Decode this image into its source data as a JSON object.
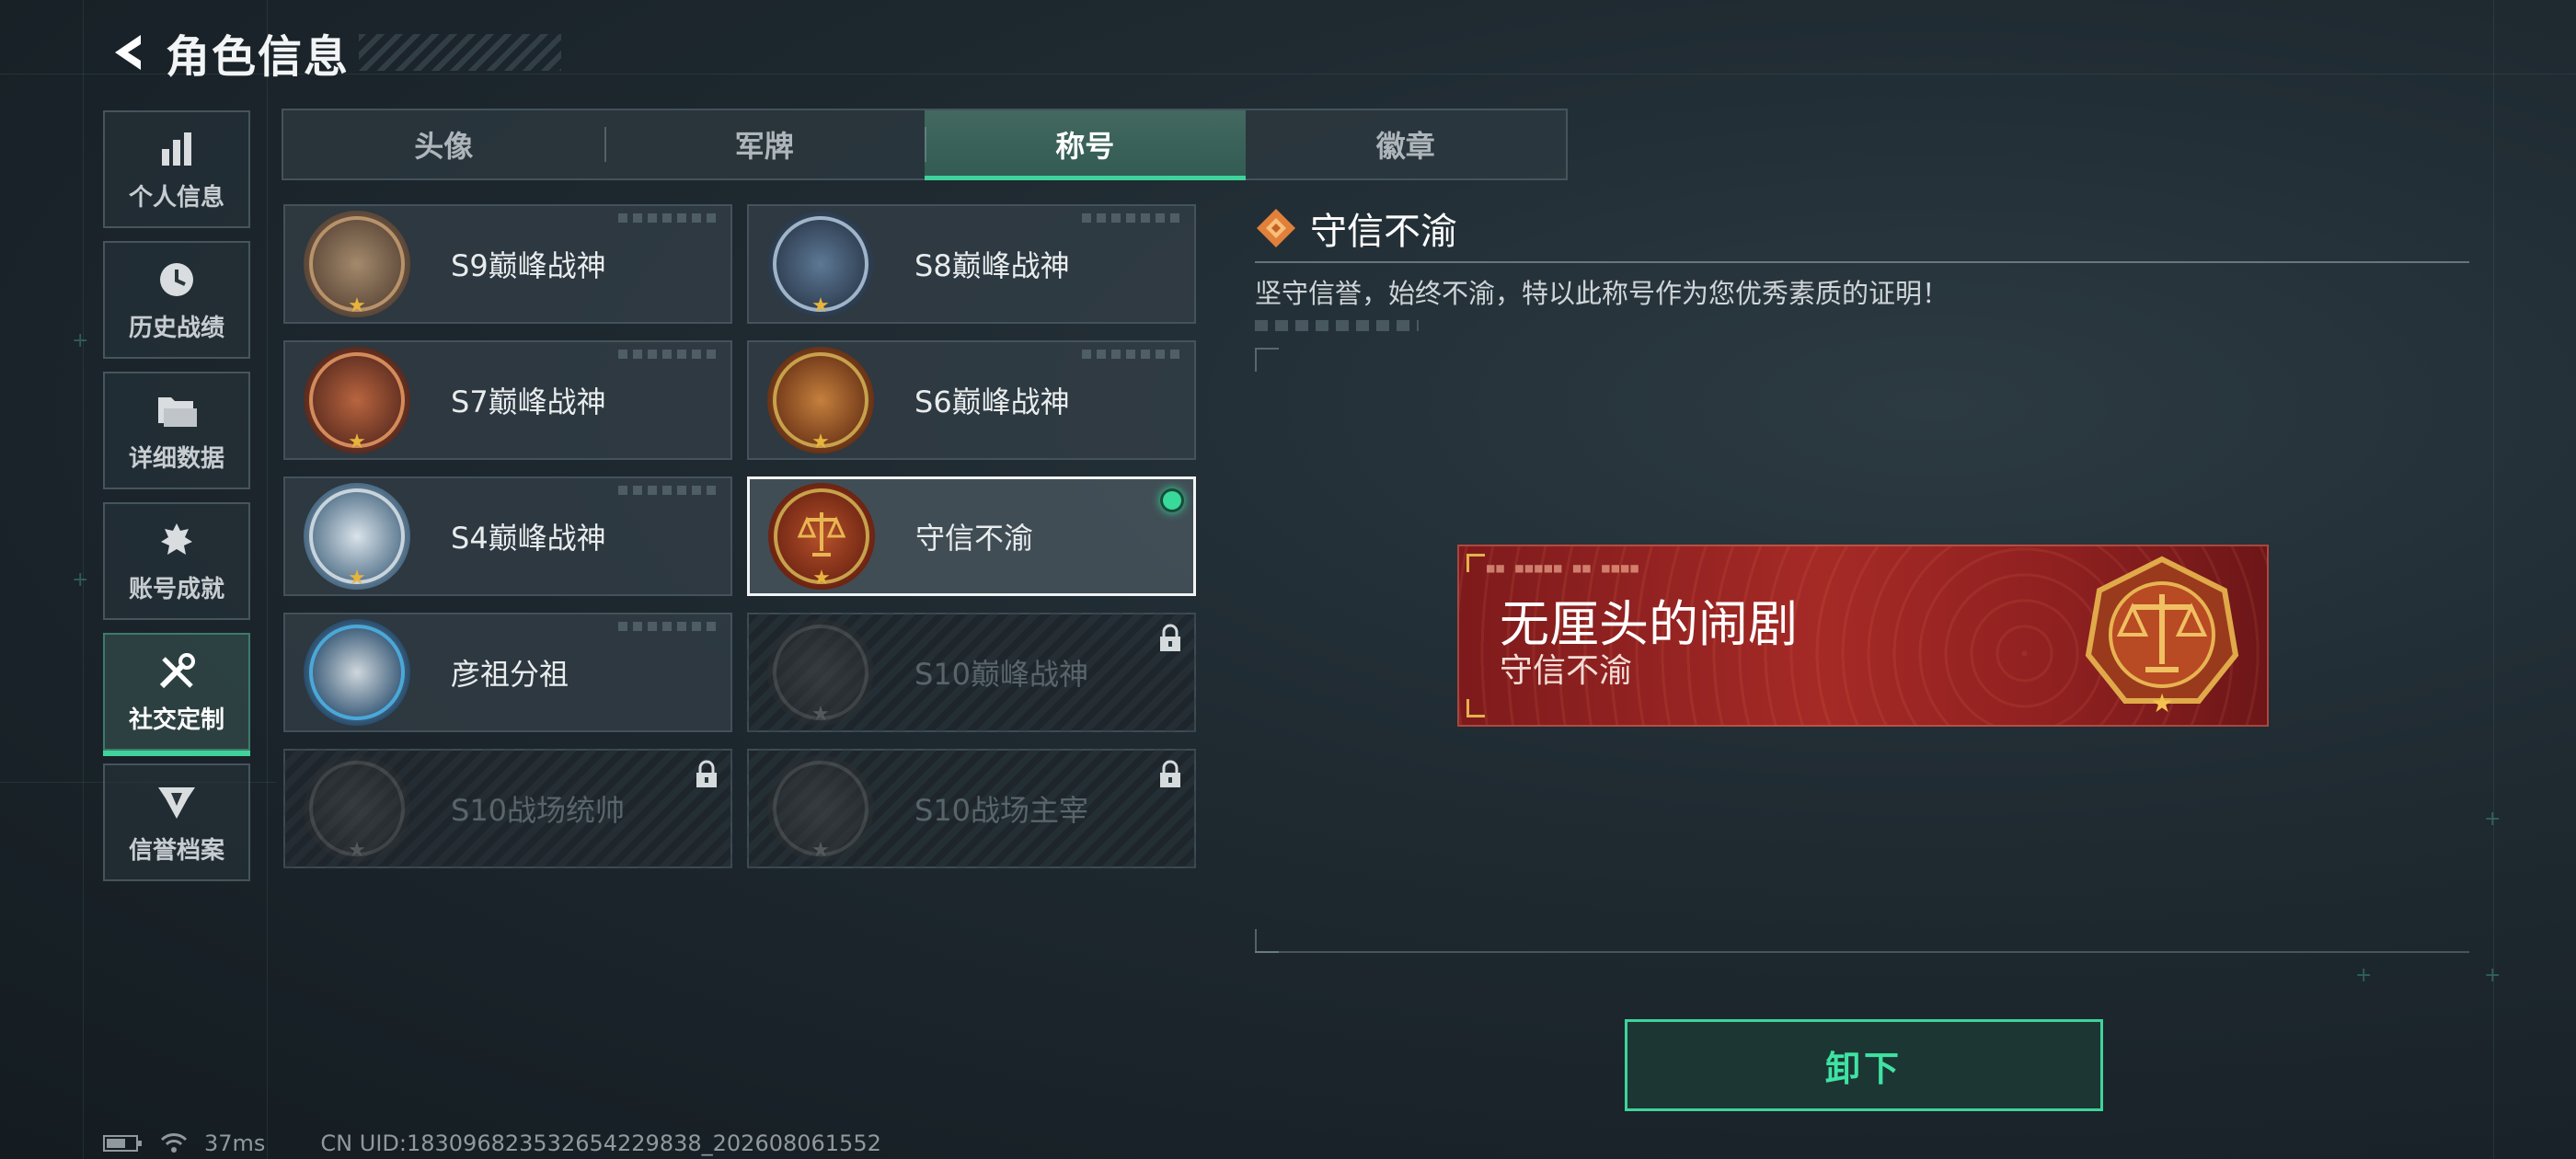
{
  "header": {
    "title": "角色信息"
  },
  "sidebar": {
    "items": [
      {
        "label": "个人信息",
        "icon": "bar-chart-icon",
        "active": false
      },
      {
        "label": "历史战绩",
        "icon": "clock-icon",
        "active": false
      },
      {
        "label": "详细数据",
        "icon": "folder-icon",
        "active": false
      },
      {
        "label": "账号成就",
        "icon": "achievement-icon",
        "active": false
      },
      {
        "label": "社交定制",
        "icon": "tools-icon",
        "active": true
      },
      {
        "label": "信誉档案",
        "icon": "credit-badge-icon",
        "active": false
      }
    ]
  },
  "tabs": [
    {
      "label": "头像",
      "active": false
    },
    {
      "label": "军牌",
      "active": false
    },
    {
      "label": "称号",
      "active": true
    },
    {
      "label": "徽章",
      "active": false
    }
  ],
  "titles": [
    {
      "name": "S9巅峰战神",
      "locked": false,
      "selected": false
    },
    {
      "name": "S8巅峰战神",
      "locked": false,
      "selected": false
    },
    {
      "name": "S7巅峰战神",
      "locked": false,
      "selected": false
    },
    {
      "name": "S6巅峰战神",
      "locked": false,
      "selected": false
    },
    {
      "name": "S4巅峰战神",
      "locked": false,
      "selected": false
    },
    {
      "name": "守信不渝",
      "locked": false,
      "selected": true,
      "equipped": true
    },
    {
      "name": "彦祖分祖",
      "locked": false,
      "selected": false
    },
    {
      "name": "S10巅峰战神",
      "locked": true,
      "selected": false
    },
    {
      "name": "S10战场统帅",
      "locked": true,
      "selected": false
    },
    {
      "name": "S10战场主宰",
      "locked": true,
      "selected": false
    }
  ],
  "detail": {
    "title": "守信不渝",
    "description": "坚守信誉，始终不渝，特以此称号作为您优秀素质的证明！"
  },
  "nameplate": {
    "player_name": "无厘头的闹剧",
    "title": "守信不渝"
  },
  "actions": {
    "unequip_label": "卸下"
  },
  "status": {
    "ping": "37ms",
    "uid": "CN UID:183096823532654229838_202608061552"
  },
  "colors": {
    "accent": "#3fd39b",
    "nameplate_red": "#a52a26",
    "gold": "#c7a14c"
  }
}
